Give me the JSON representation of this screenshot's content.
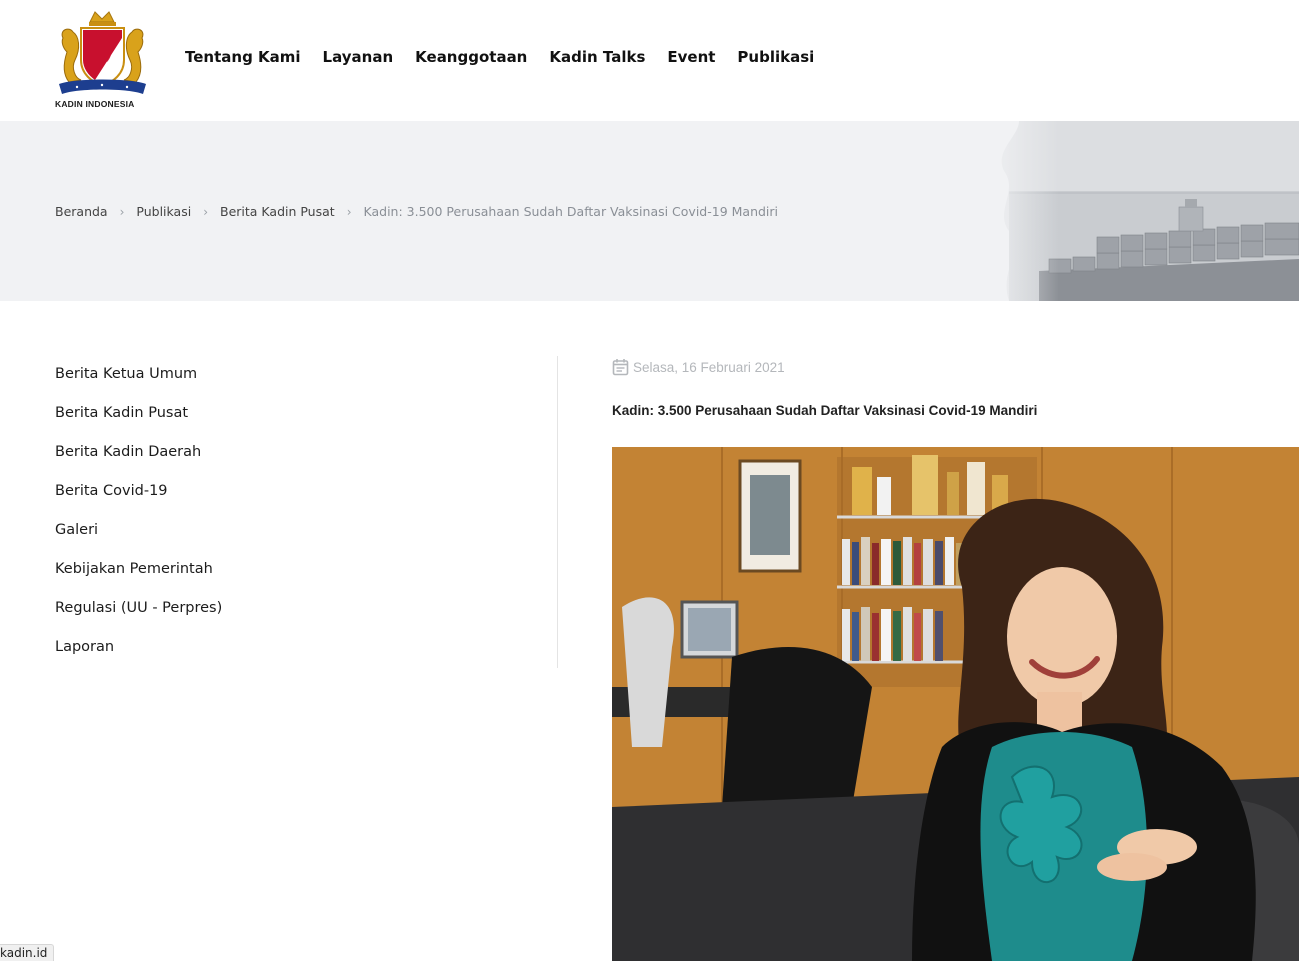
{
  "header": {
    "logo_caption": "KADIN INDONESIA",
    "nav": [
      "Tentang Kami",
      "Layanan",
      "Keanggotaan",
      "Kadin Talks",
      "Event",
      "Publikasi"
    ]
  },
  "breadcrumb": {
    "items": [
      "Beranda",
      "Publikasi",
      "Berita Kadin Pusat"
    ],
    "current": "Kadin: 3.500 Perusahaan Sudah Daftar Vaksinasi Covid-19 Mandiri"
  },
  "sidebar": {
    "items": [
      "Berita Ketua Umum",
      "Berita Kadin Pusat",
      "Berita Kadin Daerah",
      "Berita Covid-19",
      "Galeri",
      "Kebijakan Pemerintah",
      "Regulasi (UU - Perpres)",
      "Laporan"
    ]
  },
  "article": {
    "date": "Selasa, 16 Februari 2021",
    "title": "Kadin: 3.500 Perusahaan Sudah Daftar Vaksinasi Covid-19 Mandiri"
  },
  "status": {
    "url": "kadin.id"
  },
  "colors": {
    "banner_bg": "#f1f2f4",
    "date_gray": "#b4b7bb",
    "logo_red": "#c8102e",
    "logo_gold": "#d9a21b",
    "logo_blue": "#1d3e8f"
  }
}
